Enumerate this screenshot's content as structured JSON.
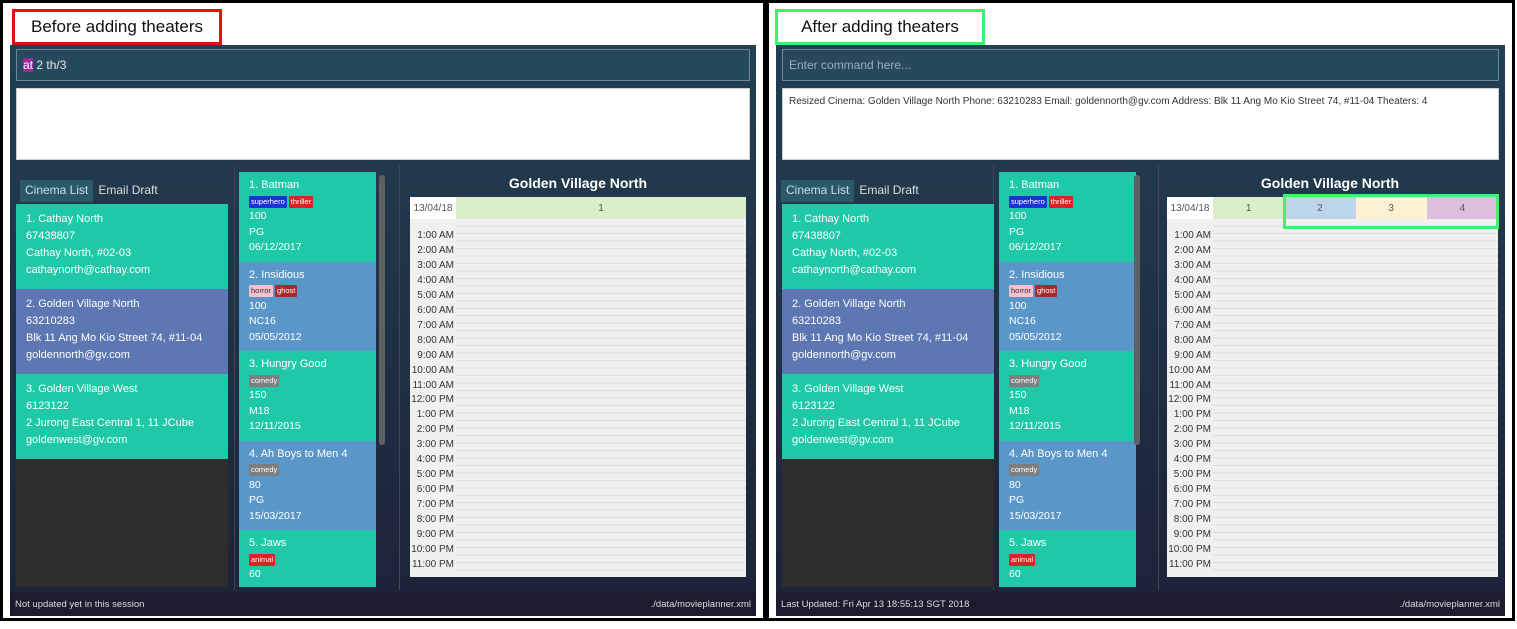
{
  "left": {
    "caption": "Before adding theaters",
    "command": {
      "selected": "at",
      "rest": " 2 th/3"
    },
    "result": "",
    "schedule_date": "13/04/18",
    "theaters": [
      "1"
    ],
    "status_left": "Not updated yet in this session",
    "status_right": "./data/movieplanner.xml"
  },
  "right": {
    "caption": "After adding theaters",
    "command_placeholder": "Enter command here...",
    "result": "Resized Cinema: Golden Village North Phone: 63210283 Email: goldennorth@gv.com Address: Blk 11 Ang Mo Kio Street 74, #11-04 Theaters: 4",
    "schedule_date": "13/04/18",
    "theaters": [
      "1",
      "2",
      "3",
      "4"
    ],
    "status_left": "Last Updated: Fri Apr 13 18:55:13 SGT 2018",
    "status_right": "./data/movieplanner.xml"
  },
  "tabs": [
    "Cinema List",
    "Email Draft"
  ],
  "cinema_title": "Golden Village North",
  "cinemas": [
    {
      "name": "1.  Cathay North",
      "phone": "67438807",
      "address": "Cathay North, #02-03",
      "email": "cathaynorth@cathay.com",
      "color": "#1fc9a8"
    },
    {
      "name": "2.  Golden Village North",
      "phone": "63210283",
      "address": "Blk 11 Ang Mo Kio Street 74, #11-04",
      "email": "goldennorth@gv.com",
      "color": "#5c77b2"
    },
    {
      "name": "3.  Golden Village West",
      "phone": "6123122",
      "address": "2 Jurong East Central 1, 11 JCube",
      "email": "goldenwest@gv.com",
      "color": "#1fc9a8"
    }
  ],
  "movies": [
    {
      "title": "1.  Batman",
      "tags": [
        {
          "t": "superhero",
          "bg": "#1d32d8",
          "fg": "#fff"
        },
        {
          "t": "thriller",
          "bg": "#d82424",
          "fg": "#fff"
        }
      ],
      "duration": "100",
      "rating": "PG",
      "date": "06/12/2017",
      "color": "#1fc9a8"
    },
    {
      "title": "2.  Insidious",
      "tags": [
        {
          "t": "horror",
          "bg": "#f4c2cf",
          "fg": "#333"
        },
        {
          "t": "ghost",
          "bg": "#a22b2b",
          "fg": "#fff"
        }
      ],
      "duration": "100",
      "rating": "NC16",
      "date": "05/05/2012",
      "color": "#5a96c8"
    },
    {
      "title": "3.  Hungry Good",
      "tags": [
        {
          "t": "comedy",
          "bg": "#7e7e7e",
          "fg": "#fff"
        }
      ],
      "duration": "150",
      "rating": "M18",
      "date": "12/11/2015",
      "color": "#1fc9a8"
    },
    {
      "title": "4.  Ah Boys to Men 4",
      "tags": [
        {
          "t": "comedy",
          "bg": "#7e7e7e",
          "fg": "#fff"
        }
      ],
      "duration": "80",
      "rating": "PG",
      "date": "15/03/2017",
      "color": "#5a96c8"
    },
    {
      "title": "5.  Jaws",
      "tags": [
        {
          "t": "animal",
          "bg": "#d82424",
          "fg": "#fff"
        }
      ],
      "duration": "60",
      "rating": "",
      "date": "",
      "color": "#1fc9a8"
    }
  ],
  "times": [
    "1:00 AM",
    "2:00 AM",
    "3:00 AM",
    "4:00 AM",
    "5:00 AM",
    "6:00 AM",
    "7:00 AM",
    "8:00 AM",
    "9:00 AM",
    "10:00 AM",
    "11:00 AM",
    "12:00 PM",
    "1:00 PM",
    "2:00 PM",
    "3:00 PM",
    "4:00 PM",
    "5:00 PM",
    "6:00 PM",
    "7:00 PM",
    "8:00 PM",
    "9:00 PM",
    "10:00 PM",
    "11:00 PM"
  ],
  "theater_colors": [
    "#d8efc8",
    "#bcd5ea",
    "#fcf1d2",
    "#dcbfde"
  ]
}
